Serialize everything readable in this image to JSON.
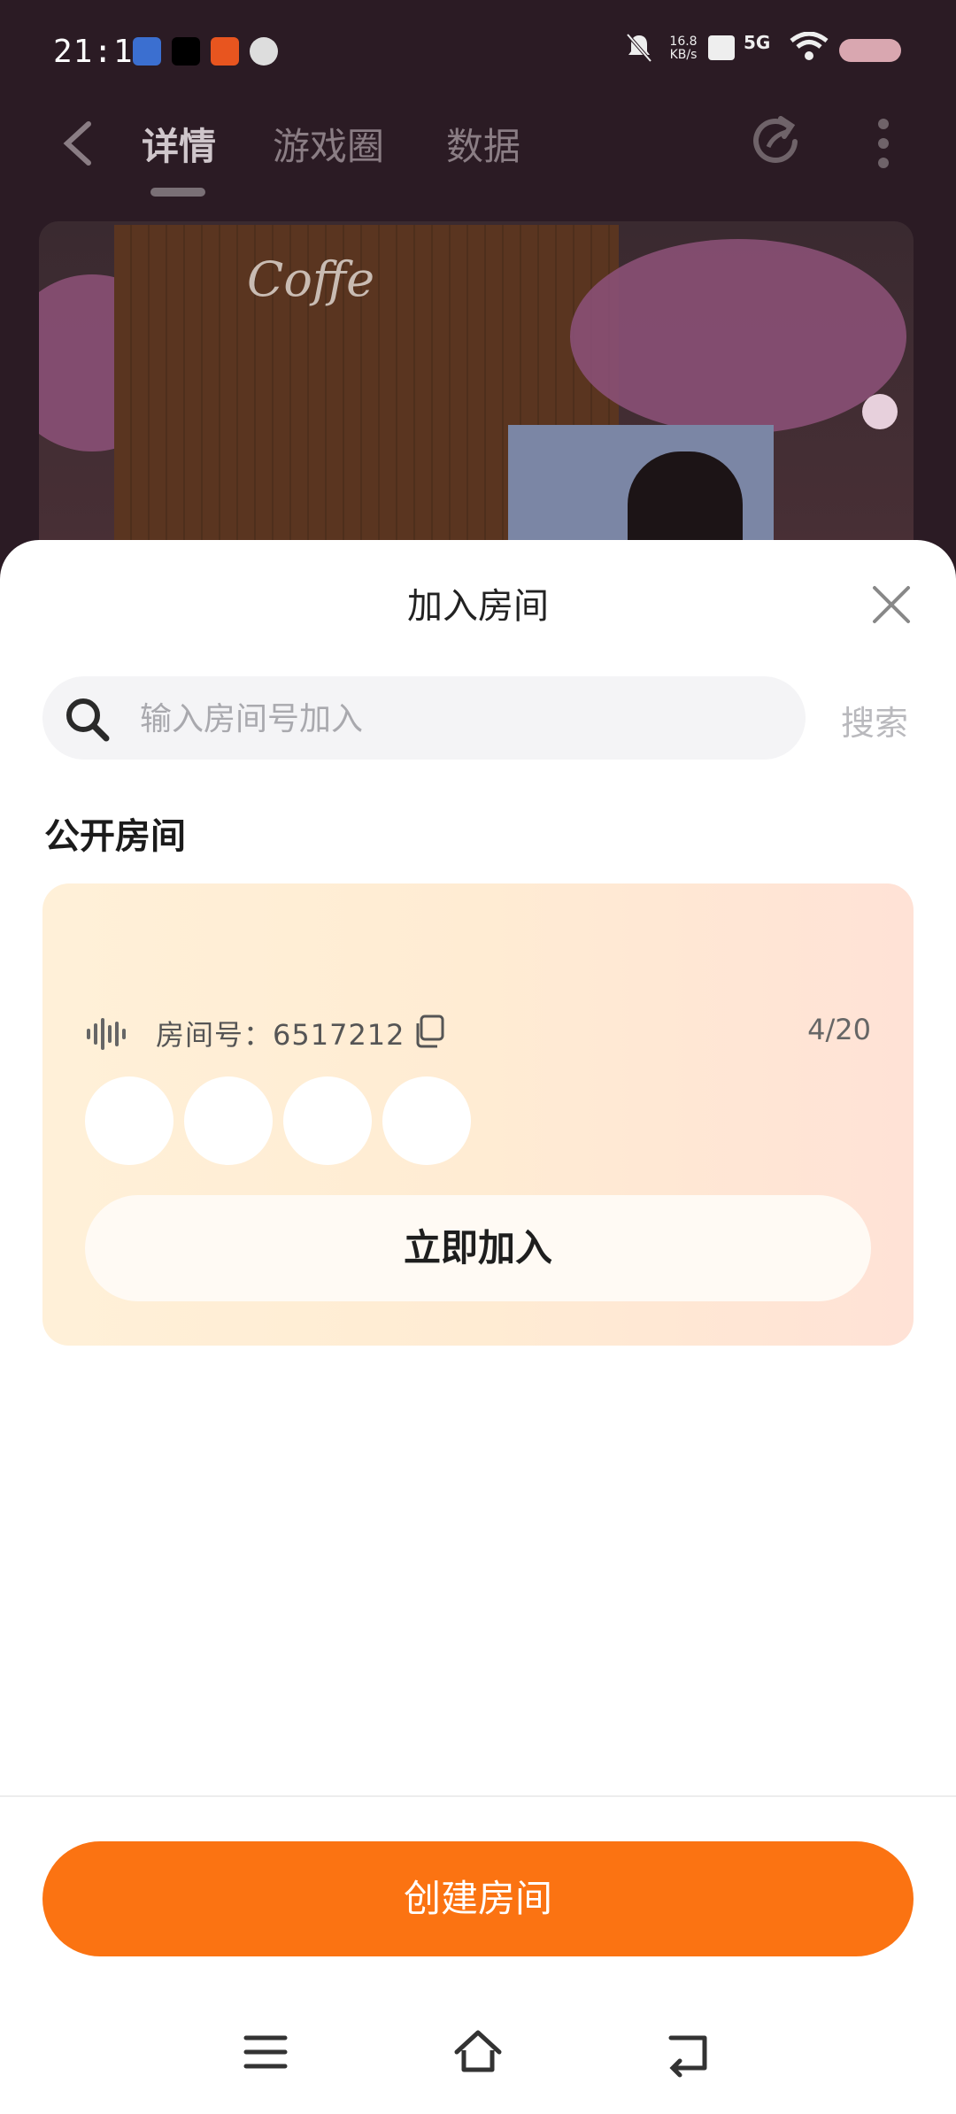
{
  "status_bar": {
    "time": "21:15",
    "net_speed": "16.8 KB/s",
    "network": "5G"
  },
  "top_nav": {
    "tabs": [
      "详情",
      "游戏圈",
      "数据"
    ],
    "active_tab": "详情"
  },
  "banner": {
    "sign_text": "Coffe"
  },
  "sheet": {
    "title": "加入房间",
    "search": {
      "placeholder": "输入房间号加入",
      "value": "",
      "button_label": "搜索"
    },
    "section_title": "公开房间",
    "rooms": [
      {
        "room_label": "房间号：6517212",
        "occupancy": "4/20",
        "avatar_count": 4,
        "join_label": "立即加入"
      }
    ],
    "create_label": "创建房间"
  },
  "colors": {
    "accent": "#fb7312",
    "card_gradient_start": "#fff0d8",
    "card_gradient_end": "#ffe2d6"
  },
  "nav_icons": [
    "menu-icon",
    "home-icon",
    "back-icon"
  ]
}
